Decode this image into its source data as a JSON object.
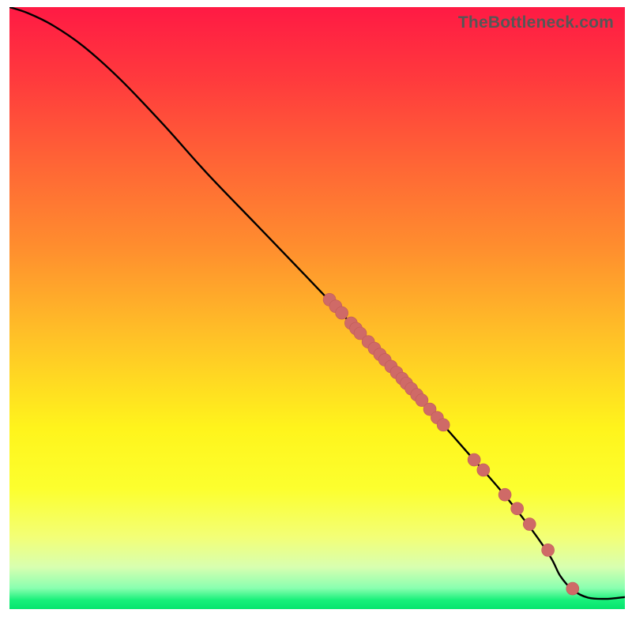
{
  "watermark": "TheBottleneck.com",
  "colors": {
    "curve": "#000000",
    "marker_fill": "#cf6a67",
    "marker_stroke": "#c05b58"
  },
  "gradient_stops": [
    {
      "offset": 0.0,
      "color": "#ff1a44"
    },
    {
      "offset": 0.12,
      "color": "#ff3a3d"
    },
    {
      "offset": 0.25,
      "color": "#ff6236"
    },
    {
      "offset": 0.4,
      "color": "#ff8e2e"
    },
    {
      "offset": 0.55,
      "color": "#ffc227"
    },
    {
      "offset": 0.7,
      "color": "#fff41c"
    },
    {
      "offset": 0.8,
      "color": "#fcff2e"
    },
    {
      "offset": 0.88,
      "color": "#f3ff76"
    },
    {
      "offset": 0.93,
      "color": "#d8ffb0"
    },
    {
      "offset": 0.965,
      "color": "#8affb0"
    },
    {
      "offset": 0.985,
      "color": "#18f07a"
    },
    {
      "offset": 1.0,
      "color": "#06e56e"
    }
  ],
  "chart_data": {
    "type": "line",
    "title": "",
    "xlabel": "",
    "ylabel": "",
    "xlim": [
      0,
      100
    ],
    "ylim": [
      0,
      100
    ],
    "series": [
      {
        "name": "curve",
        "x": [
          0,
          3,
          7,
          12,
          18,
          25,
          32,
          40,
          48,
          55,
          62,
          68,
          74,
          80,
          85,
          88,
          89.5,
          91.5,
          94,
          97,
          100
        ],
        "y": [
          100,
          99,
          97,
          93.5,
          88,
          80.5,
          72.5,
          64,
          55.5,
          48,
          40.5,
          33.5,
          26.5,
          19.5,
          13,
          8.5,
          5.5,
          3.2,
          1.9,
          1.7,
          2.0
        ]
      }
    ],
    "markers": [
      {
        "x": 52.0,
        "y": 51.4
      },
      {
        "x": 53.0,
        "y": 50.3
      },
      {
        "x": 54.0,
        "y": 49.2
      },
      {
        "x": 55.5,
        "y": 47.5
      },
      {
        "x": 56.3,
        "y": 46.6
      },
      {
        "x": 57.0,
        "y": 45.8
      },
      {
        "x": 58.3,
        "y": 44.4
      },
      {
        "x": 59.3,
        "y": 43.3
      },
      {
        "x": 60.2,
        "y": 42.3
      },
      {
        "x": 61.0,
        "y": 41.4
      },
      {
        "x": 62.0,
        "y": 40.3
      },
      {
        "x": 62.9,
        "y": 39.3
      },
      {
        "x": 63.8,
        "y": 38.3
      },
      {
        "x": 64.5,
        "y": 37.5
      },
      {
        "x": 65.3,
        "y": 36.6
      },
      {
        "x": 66.2,
        "y": 35.6
      },
      {
        "x": 67.0,
        "y": 34.7
      },
      {
        "x": 68.3,
        "y": 33.2
      },
      {
        "x": 69.5,
        "y": 31.8
      },
      {
        "x": 70.5,
        "y": 30.6
      },
      {
        "x": 75.5,
        "y": 24.8
      },
      {
        "x": 77.0,
        "y": 23.1
      },
      {
        "x": 80.5,
        "y": 19.0
      },
      {
        "x": 82.5,
        "y": 16.7
      },
      {
        "x": 84.5,
        "y": 14.1
      },
      {
        "x": 87.5,
        "y": 9.8
      },
      {
        "x": 91.5,
        "y": 3.4
      }
    ],
    "marker_radius": 8
  }
}
